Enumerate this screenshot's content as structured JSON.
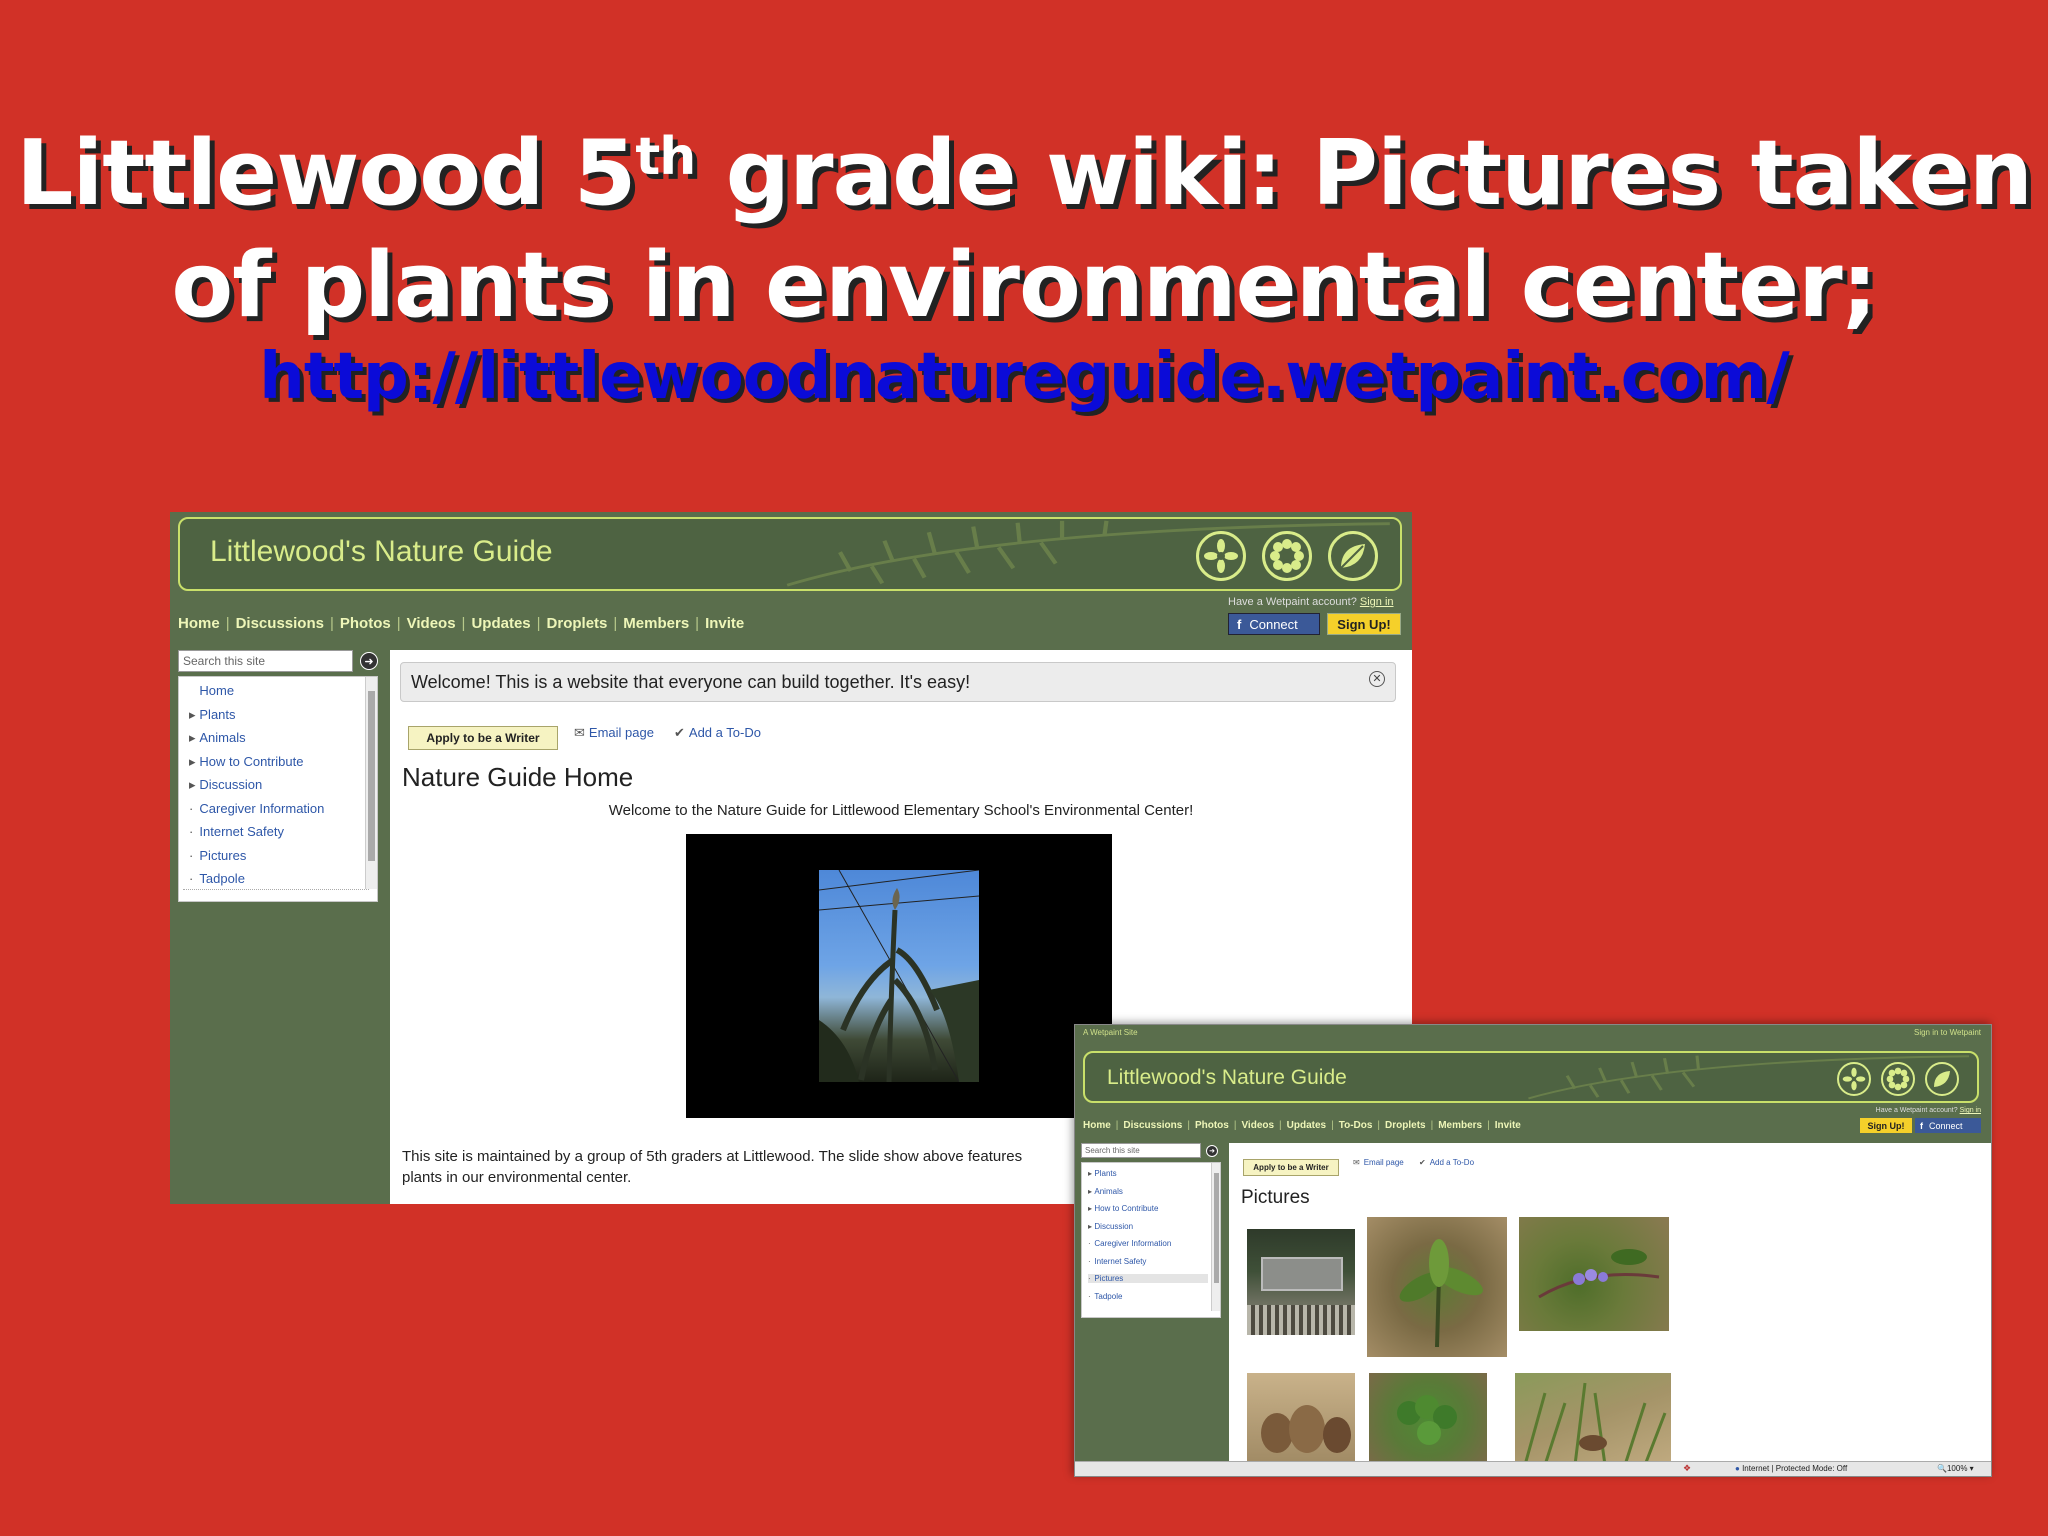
{
  "slide": {
    "title_part1": "Littlewood 5",
    "title_sup": "th",
    "title_part2": " grade wiki: Pictures taken",
    "title_line2": "of plants in environmental center;",
    "url": "http://littlewoodnatureguide.wetpaint.com/"
  },
  "wiki_main": {
    "site_title": "Littlewood's Nature Guide",
    "nav": [
      "Home",
      "Discussions",
      "Photos",
      "Videos",
      "Updates",
      "Droplets",
      "Members",
      "Invite"
    ],
    "account_prompt": "Have a Wetpaint account?",
    "sign_in": "Sign in",
    "connect_label": "Connect",
    "signup_label": "Sign Up!",
    "search_placeholder": "Search this site",
    "sidebar": [
      "Home",
      "Plants",
      "Animals",
      "How to Contribute",
      "Discussion",
      "Caregiver Information",
      "Internet Safety",
      "Pictures",
      "Tadpole"
    ],
    "welcome_banner": "Welcome! This is a website that everyone can build together. It's easy!",
    "apply_button": "Apply to be a Writer",
    "email_page": "Email page",
    "add_todo": "Add a To-Do",
    "page_title": "Nature Guide Home",
    "intro": "Welcome to the Nature Guide for Littlewood Elementary School's Environmental Center!",
    "footer_line1": "This site is maintained by a group of 5th graders at Littlewood. The slide show above features",
    "footer_line2": "plants in our environmental center."
  },
  "wiki_pictures": {
    "top_left": "A Wetpaint Site",
    "top_right": "Sign in to Wetpaint",
    "site_title": "Littlewood's Nature Guide",
    "nav": [
      "Home",
      "Discussions",
      "Photos",
      "Videos",
      "Updates",
      "To-Dos",
      "Droplets",
      "Members",
      "Invite"
    ],
    "account_prompt": "Have a Wetpaint account?",
    "sign_in": "Sign in",
    "signup_label": "Sign Up!",
    "connect_label": "Connect",
    "search_placeholder": "Search this site",
    "sidebar": [
      "Plants",
      "Animals",
      "How to Contribute",
      "Discussion",
      "Caregiver Information",
      "Internet Safety",
      "Pictures",
      "Tadpole"
    ],
    "apply_button": "Apply to be a Writer",
    "email_page": "Email page",
    "add_todo": "Add a To-Do",
    "page_title": "Pictures",
    "status_zone": "Internet | Protected Mode: Off",
    "zoom": "100%"
  },
  "colors": {
    "slide_bg": "#d13127",
    "wiki_green": "#5a6e4c",
    "accent_lime": "#d9ec8a",
    "url_blue": "#0b0bd8"
  }
}
